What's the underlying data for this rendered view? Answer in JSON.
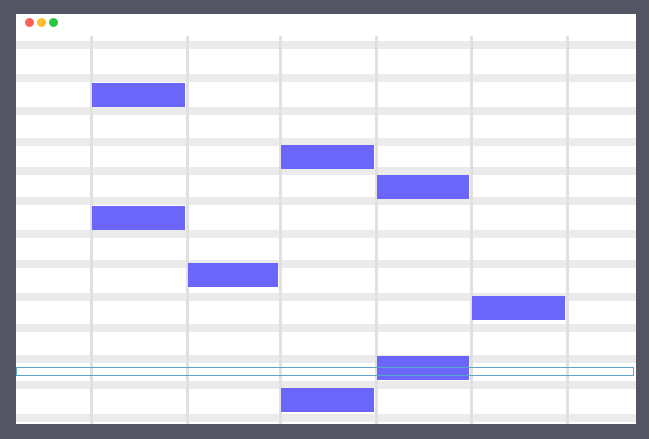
{
  "window": {
    "controls": [
      {
        "name": "close",
        "color": "#fe5f57"
      },
      {
        "name": "minimize",
        "color": "#febc2e"
      },
      {
        "name": "zoom",
        "color": "#29c840"
      }
    ]
  },
  "colors": {
    "stripe": "#ebebeb",
    "grid_line": "#e0e0e0",
    "block": "#6b66f9",
    "selection_border": "#5aa6c8"
  },
  "grid": {
    "columns": 7,
    "rows": 12,
    "selected_row_index": 10,
    "blocks": [
      {
        "column": 1,
        "row": 1
      },
      {
        "column": 3,
        "row": 3
      },
      {
        "column": 4,
        "row": 4
      },
      {
        "column": 1,
        "row": 5
      },
      {
        "column": 2,
        "row": 7
      },
      {
        "column": 5,
        "row": 8
      },
      {
        "column": 4,
        "row": 10
      },
      {
        "column": 3,
        "row": 11
      }
    ]
  }
}
